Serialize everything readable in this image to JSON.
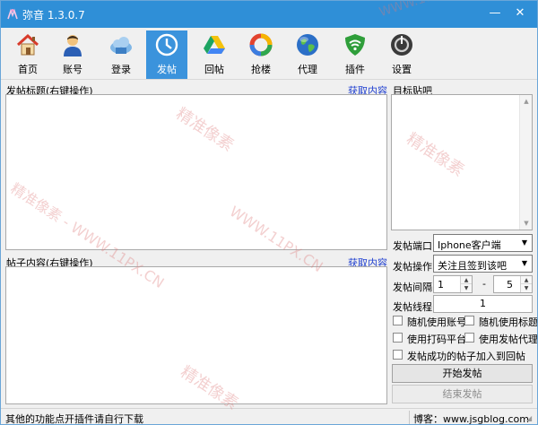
{
  "window": {
    "title": "弥音 1.3.0.7"
  },
  "titlebar": {
    "minimize": "—",
    "close": "✕"
  },
  "toolbar": {
    "items": [
      {
        "label": "首页",
        "icon": "home-icon"
      },
      {
        "label": "账号",
        "icon": "account-user-icon"
      },
      {
        "label": "登录",
        "icon": "login-cloud-icon"
      },
      {
        "label": "发帖",
        "icon": "clock-icon"
      },
      {
        "label": "回帖",
        "icon": "drive-triangle-icon"
      },
      {
        "label": "抢楼",
        "icon": "ring-icon"
      },
      {
        "label": "代理",
        "icon": "globe-icon"
      },
      {
        "label": "插件",
        "icon": "wifi-shield-icon"
      },
      {
        "label": "设置",
        "icon": "power-gauge-icon"
      }
    ],
    "active_index": 3
  },
  "left": {
    "title_label": "发帖标题(右键操作)",
    "title_fetch": "获取内容",
    "title_value": "",
    "content_label": "帖子内容(右键操作)",
    "content_fetch": "获取内容",
    "content_value": ""
  },
  "right": {
    "target_label": "目标贴吧",
    "port_label": "发帖端口",
    "port_value": "Iphone客户端",
    "op_label": "发帖操作",
    "op_value": "关注且签到该吧",
    "interval_label": "发帖间隔",
    "interval_min": "1",
    "interval_sep": "-",
    "interval_max": "5",
    "threads_label": "发帖线程",
    "threads_value": "1",
    "checks": {
      "random_account": "随机使用账号",
      "random_title": "随机使用标题",
      "captcha": "使用打码平台",
      "proxy": "使用发帖代理",
      "add_reply": "发帖成功的帖子加入到回帖"
    },
    "start_button": "开始发帖",
    "stop_button": "结束发帖"
  },
  "status": {
    "left": "其他的功能点开插件请自行下载",
    "right": "博客：www.jsgblog.com"
  },
  "watermarks": [
    "精准像素",
    "WWW.11PX.CN",
    "精准像素 - WWW.11PX.CN",
    "WWW.11PX.CN"
  ],
  "colors": {
    "titlebar": "#2f8fd7",
    "active_tab": "#3b93dc",
    "link": "#1f3fd0"
  }
}
